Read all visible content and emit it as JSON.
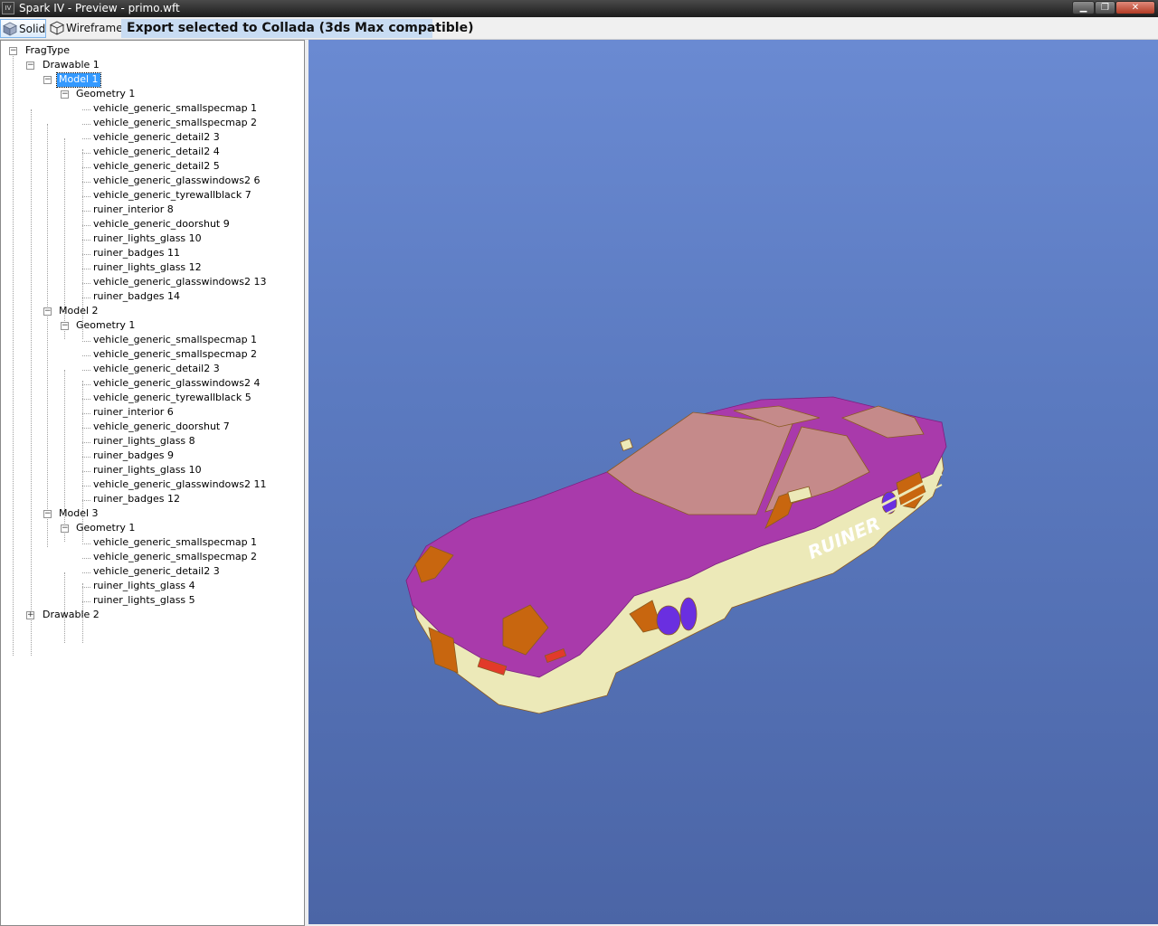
{
  "window": {
    "title": "Spark IV - Preview - primo.wft",
    "icon_label": "IV",
    "controls": [
      "minimize",
      "maximize",
      "close"
    ]
  },
  "toolbar": {
    "solid_label": "Solid",
    "wireframe_label": "Wireframe",
    "export_label": "Export selected to Collada (3ds Max compatible)"
  },
  "tree": {
    "root": "FragType",
    "drawable1": {
      "label": "Drawable 1",
      "models": [
        {
          "label": "Model 1",
          "selected": true,
          "geometry": "Geometry 1",
          "items": [
            "vehicle_generic_smallspecmap 1",
            "vehicle_generic_smallspecmap 2",
            "vehicle_generic_detail2 3",
            "vehicle_generic_detail2 4",
            "vehicle_generic_detail2 5",
            "vehicle_generic_glasswindows2 6",
            "vehicle_generic_tyrewallblack 7",
            "ruiner_interior 8",
            "vehicle_generic_doorshut 9",
            "ruiner_lights_glass 10",
            "ruiner_badges 11",
            "ruiner_lights_glass 12",
            "vehicle_generic_glasswindows2 13",
            "ruiner_badges 14"
          ]
        },
        {
          "label": "Model 2",
          "selected": false,
          "geometry": "Geometry 1",
          "items": [
            "vehicle_generic_smallspecmap 1",
            "vehicle_generic_smallspecmap 2",
            "vehicle_generic_detail2 3",
            "vehicle_generic_glasswindows2 4",
            "vehicle_generic_tyrewallblack 5",
            "ruiner_interior 6",
            "vehicle_generic_doorshut 7",
            "ruiner_lights_glass 8",
            "ruiner_badges 9",
            "ruiner_lights_glass 10",
            "vehicle_generic_glasswindows2 11",
            "ruiner_badges 12"
          ]
        },
        {
          "label": "Model 3",
          "selected": false,
          "geometry": "Geometry 1",
          "items": [
            "vehicle_generic_smallspecmap 1",
            "vehicle_generic_smallspecmap 2",
            "vehicle_generic_detail2 3",
            "ruiner_lights_glass 4",
            "ruiner_lights_glass 5"
          ]
        }
      ]
    },
    "drawable2": {
      "label": "Drawable 2",
      "collapsed": true
    }
  },
  "viewport": {
    "model_text": "RUINER",
    "colors": {
      "background_top": "#6a8ad2",
      "background_bottom": "#4b65a6",
      "body": "#a93aab",
      "glass": "#c58a8a",
      "trim": "#ece9b8",
      "detail": "#c8660f",
      "wheel": "#6a2fe0"
    }
  }
}
